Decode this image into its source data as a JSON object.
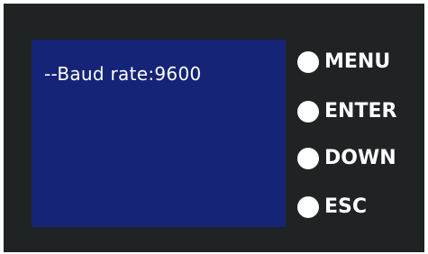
{
  "display": {
    "text": "--Baud rate:9600"
  },
  "buttons": {
    "menu": {
      "label": "MENU",
      "icon": "circle-button-icon"
    },
    "enter": {
      "label": "ENTER",
      "icon": "circle-button-icon"
    },
    "down": {
      "label": "DOWN",
      "icon": "circle-button-icon"
    },
    "esc": {
      "label": "ESC",
      "icon": "circle-button-icon"
    }
  },
  "colors": {
    "panel": "#202324",
    "screen": "#152476",
    "text": "#ffffff"
  }
}
